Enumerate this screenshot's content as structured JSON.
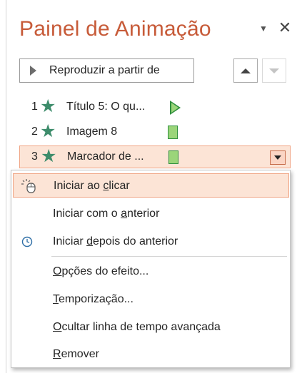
{
  "pane": {
    "title": "Painel de Animação",
    "options_glyph": "▼",
    "close_glyph": "✕"
  },
  "toolbar": {
    "play_from_label": "Reproduzir a partir de",
    "move_up_icon": "arrow-up-icon",
    "move_down_icon": "arrow-down-icon"
  },
  "animations": [
    {
      "number": "1",
      "name": "Título 5: O qu...",
      "timing": "on-click",
      "effect_icon": "star-icon"
    },
    {
      "number": "2",
      "name": "Imagem 8",
      "timing": "with-previous",
      "effect_icon": "star-icon"
    },
    {
      "number": "3",
      "name": "Marcador de ...",
      "timing": "with-previous",
      "effect_icon": "star-icon",
      "selected": true
    }
  ],
  "context_menu": {
    "items": [
      {
        "pre": "Iniciar ao ",
        "key": "c",
        "post": "licar",
        "icon": "mouse-icon",
        "active": true
      },
      {
        "pre": "Iniciar com o ",
        "key": "a",
        "post": "nterior",
        "icon": "",
        "active": false
      },
      {
        "pre": "Iniciar ",
        "key": "d",
        "post": "epois do anterior",
        "icon": "clock-icon",
        "active": false
      },
      {
        "pre": "",
        "key": "O",
        "post": "pções do efeito...",
        "icon": "",
        "active": false
      },
      {
        "pre": "",
        "key": "T",
        "post": "emporização...",
        "icon": "",
        "active": false
      },
      {
        "pre": "",
        "key": "O",
        "post": "cultar linha de tempo avançada",
        "icon": "",
        "active": false
      },
      {
        "pre": "",
        "key": "R",
        "post": "emover",
        "icon": "",
        "active": false
      }
    ]
  },
  "colors": {
    "title": "#c75b39",
    "selection_fill": "#fce4d6",
    "selection_border": "#f0a585",
    "effect_star": "#3d8c6b",
    "timing_bar": "#9bd57a"
  }
}
